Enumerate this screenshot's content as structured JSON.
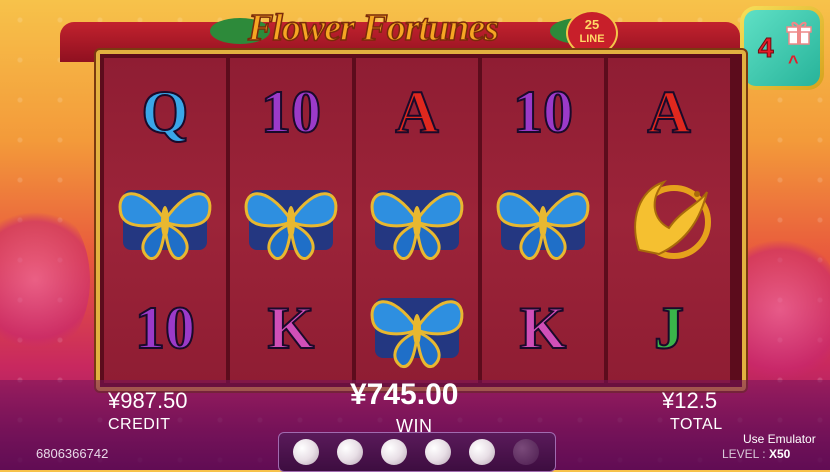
{
  "title": {
    "text": "Flower Fortunes",
    "badge_number": "25",
    "badge_label": "LINE"
  },
  "bonus": {
    "count": "4",
    "icon": "gift-icon"
  },
  "reels": [
    [
      "Q",
      "butterfly",
      "10"
    ],
    [
      "10",
      "butterfly",
      "K"
    ],
    [
      "A",
      "butterfly",
      "butterfly"
    ],
    [
      "10",
      "butterfly",
      "K"
    ],
    [
      "A",
      "phoenix",
      "J"
    ]
  ],
  "stats": {
    "credit_value": "¥987.50",
    "credit_label": "CREDIT",
    "win_value": "¥745.00",
    "win_label": "WIN",
    "total_value": "¥12.5",
    "total_label": "TOTAL"
  },
  "pearls": {
    "total": 6,
    "lit": 5
  },
  "account_id": "6806366742",
  "emulator": "Use Emulator",
  "level": {
    "label": "LEVEL :",
    "value": "X50"
  }
}
